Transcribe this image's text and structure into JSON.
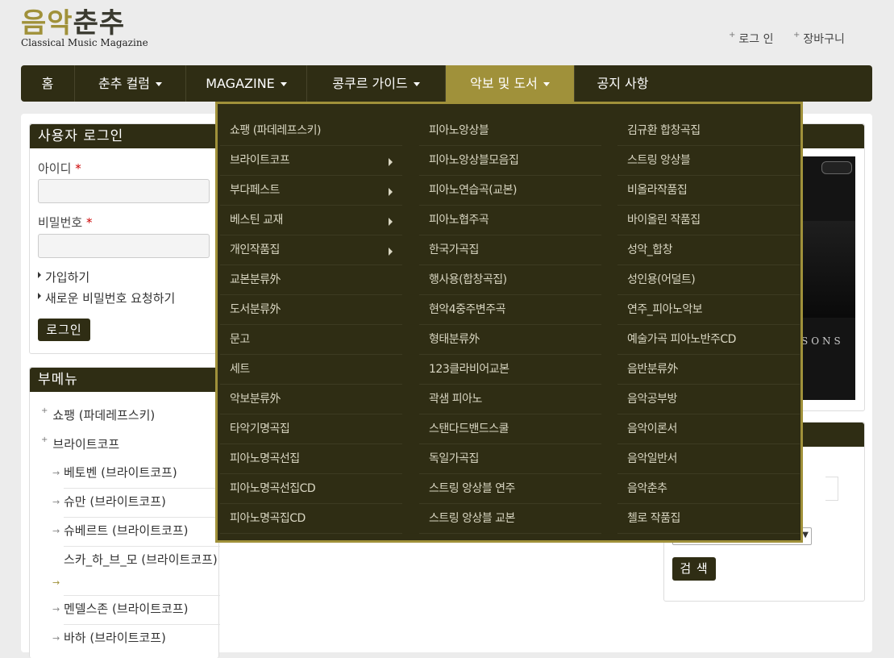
{
  "header": {
    "logo_main_gold": "음악",
    "logo_main_dark": "춘추",
    "logo_sub": "Classical Music Magazine",
    "login": "로그 인",
    "cart": "장바구니"
  },
  "nav": {
    "items": [
      {
        "label": "홈"
      },
      {
        "label": "춘추 컬럼"
      },
      {
        "label": "MAGAZINE"
      },
      {
        "label": "콩쿠르 가이드"
      },
      {
        "label": "악보 및 도서"
      },
      {
        "label": "공지 사항"
      }
    ]
  },
  "dropdown": {
    "col1": [
      "쇼팽 (파데레프스키)",
      "브라이트코프",
      "부다페스트",
      "베스틴 교재",
      "개인작품집",
      "교본분류外",
      "도서분류外",
      "문고",
      "세트",
      "악보분류外",
      "타악기명곡집",
      "피아노명곡선집",
      "피아노명곡선집CD",
      "피아노명곡집CD"
    ],
    "col2": [
      "피아노앙상블",
      "피아노앙상블모음집",
      "피아노연습곡(교본)",
      "피아노협주곡",
      "한국가곡집",
      "행사용(합창곡집)",
      "현악4중주변주곡",
      "형태분류外",
      "123클라비어교본",
      "곽샘 피아노",
      "스탠다드밴드스쿨",
      "독일가곡집",
      "스트링 앙상블 연주",
      "스트링 앙상블 교본"
    ],
    "col3": [
      "김규환 합창곡집",
      "스트링 앙상블",
      "비올라작품집",
      "바이올린 작품집",
      "성악_합창",
      "성인용(어덜트)",
      "연주_피아노악보",
      "예술가곡 피아노반주CD",
      "음반분류外",
      "음악공부방",
      "음악이론서",
      "음악일반서",
      "음악춘추",
      "첼로 작품집"
    ]
  },
  "login": {
    "title": "사용자 로그인",
    "id_label": "아이디",
    "pw_label": "비밀번호",
    "required": "*",
    "register": "가입하기",
    "new_password": "새로운 비밀번호 요청하기",
    "login_button": "로그인"
  },
  "submenu": {
    "title": "부메뉴",
    "items": [
      "쇼팽 (파데레프스키)",
      "브라이트코프"
    ],
    "children": [
      "베토벤 (브라이트코프)",
      "슈만 (브라이트코프)",
      "슈베르트 (브라이트코프)",
      "스카_하_브_모 (브라이트코프)",
      "멘델스존 (브라이트코프)",
      "바하 (브라이트코프)"
    ]
  },
  "right": {
    "image_text": "SONS",
    "search_button": "검 색"
  }
}
